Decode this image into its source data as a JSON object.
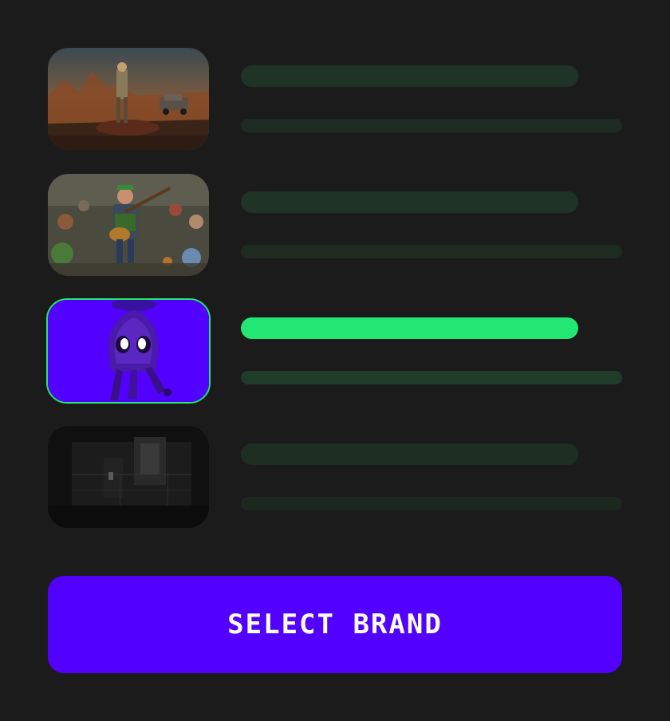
{
  "brands": [
    {
      "image_name": "desert-soldier-artwork",
      "selected": false
    },
    {
      "image_name": "guitar-hero-artwork",
      "selected": false
    },
    {
      "image_name": "purple-squid-character",
      "selected": true
    },
    {
      "image_name": "dark-dungeon-scene",
      "selected": false
    }
  ],
  "select_button": {
    "label": "SELECT BRAND"
  },
  "colors": {
    "background": "#1b1b1b",
    "accent_green": "#22e873",
    "placeholder_green": "#1f3326",
    "button_purple": "#5200ff",
    "button_text": "#ffffff"
  }
}
